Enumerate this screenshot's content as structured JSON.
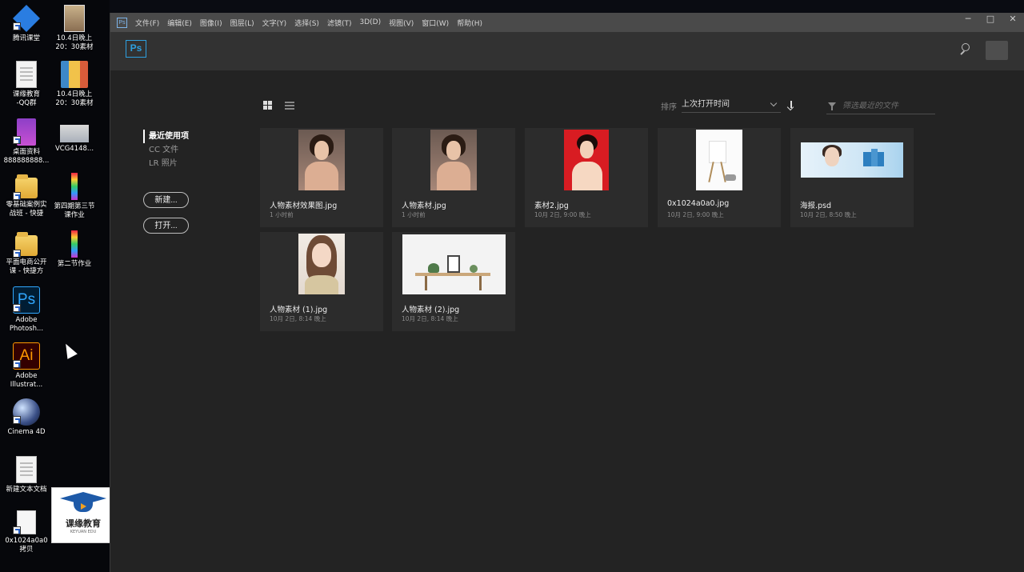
{
  "desktop": {
    "icons": [
      {
        "label": "腾讯课堂"
      },
      {
        "label": "10.4日晚上\n20：30素材"
      },
      {
        "label": "课缘教育\n-QQ群"
      },
      {
        "label": "10.4日晚上\n20：30素材"
      },
      {
        "label": "桌面资料\n888888888..."
      },
      {
        "label": "VCG4148..."
      },
      {
        "label": "零基础案例实\n战班 - 快捷"
      },
      {
        "label": "第四期第三节\n课作业"
      },
      {
        "label": "平面电商公开\n课 - 快捷方"
      },
      {
        "label": "第二节作业"
      },
      {
        "label": "Adobe\nPhotosh...",
        "glyph": "Ps"
      },
      {
        "label": "Adobe\nIllustrat...",
        "glyph": "Ai"
      },
      {
        "label": "Cinema 4D"
      },
      {
        "label": "新建文本文档"
      },
      {
        "label": "0x1024a0a0\n拷贝"
      }
    ],
    "watermark": {
      "title": "课缘教育",
      "subtitle": "KEYUAN EDU"
    }
  },
  "ps": {
    "logo_small": "Ps",
    "menu": [
      "文件(F)",
      "编辑(E)",
      "图像(I)",
      "图层(L)",
      "文字(Y)",
      "选择(S)",
      "滤镜(T)",
      "3D(D)",
      "视图(V)",
      "窗口(W)",
      "帮助(H)"
    ],
    "window_controls": {
      "minimize": "─",
      "maximize": "□",
      "close": "✕"
    },
    "home_logo": "Ps",
    "nav": {
      "items": [
        "最近使用项",
        "CC 文件",
        "LR 照片"
      ],
      "new_button": "新建...",
      "open_button": "打开..."
    },
    "sort": {
      "label": "排序",
      "value": "上次打开时间"
    },
    "filter": {
      "placeholder": "筛选最近的文件"
    },
    "files": [
      {
        "name": "人物素材效果图.jpg",
        "time": "1 小时前"
      },
      {
        "name": "人物素材.jpg",
        "time": "1 小时前"
      },
      {
        "name": "素材2.jpg",
        "time": "10月 2日, 9:00 晚上"
      },
      {
        "name": "0x1024a0a0.jpg",
        "time": "10月 2日, 9:00 晚上"
      },
      {
        "name": "海报.psd",
        "time": "10月 2日, 8:50 晚上"
      },
      {
        "name": "人物素材 (1).jpg",
        "time": "10月 2日, 8:14 晚上"
      },
      {
        "name": "人物素材 (2).jpg",
        "time": "10月 2日, 8:14 晚上"
      }
    ]
  }
}
